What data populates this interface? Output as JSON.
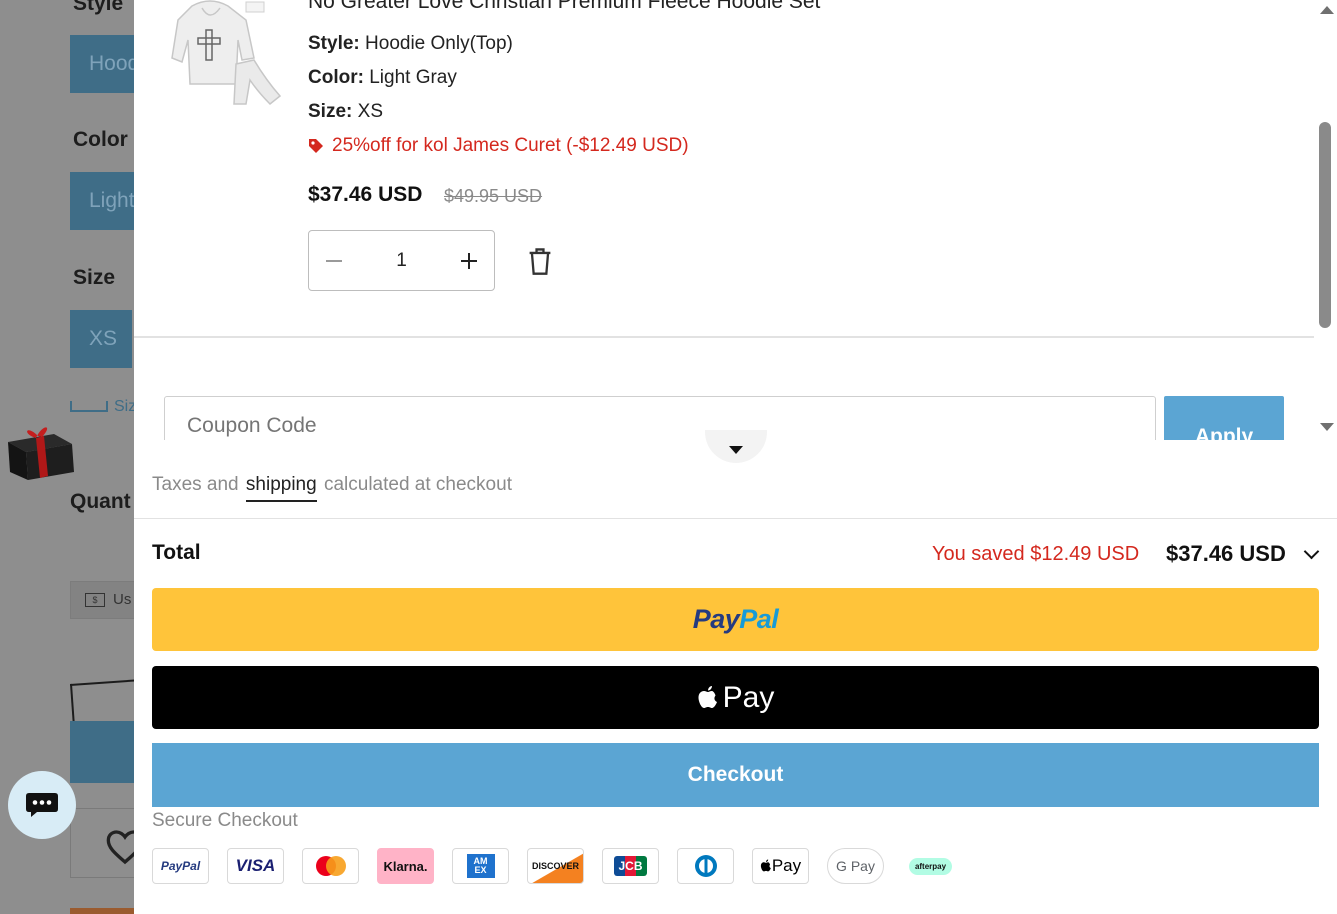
{
  "background_page": {
    "style_label": "Style",
    "style_value": "Hood",
    "color_label": "Color",
    "color_value": "Light",
    "size_label": "Size",
    "size_value": "XS",
    "size_guide": "Siz",
    "quantity_label": "Quant",
    "currency_label": "Us"
  },
  "cart": {
    "item": {
      "title": "No Greater Love Christian Premium Fleece Hoodie Set",
      "style_label": "Style:",
      "style_value": "Hoodie Only(Top)",
      "color_label": "Color:",
      "color_value": "Light Gray",
      "size_label": "Size:",
      "size_value": "XS",
      "discount": "25%off for kol James Curet (-$12.49 USD)",
      "price": "$37.46 USD",
      "compare_price": "$49.95 USD",
      "quantity": "1"
    },
    "coupon": {
      "placeholder": "Coupon Code",
      "apply_label": "Apply"
    },
    "tax_note": {
      "before": "Taxes and",
      "link": "shipping",
      "after": "calculated at checkout"
    },
    "total": {
      "label": "Total",
      "saved": "You saved $12.49 USD",
      "amount": "$37.46 USD"
    },
    "buttons": {
      "paypal_part1": "Pay",
      "paypal_part2": "Pal",
      "applepay": "Pay",
      "checkout": "Checkout"
    },
    "secure_label": "Secure Checkout",
    "payment_icons": [
      {
        "name": "paypal",
        "label": "PayPal"
      },
      {
        "name": "visa",
        "label": "VISA"
      },
      {
        "name": "mastercard",
        "label": ""
      },
      {
        "name": "klarna",
        "label": "Klarna."
      },
      {
        "name": "amex",
        "label": "AM EX"
      },
      {
        "name": "discover",
        "label": "DISCOVER"
      },
      {
        "name": "jcb",
        "label": "JCB"
      },
      {
        "name": "diners",
        "label": ""
      },
      {
        "name": "apple-pay",
        "label": "Pay"
      },
      {
        "name": "google-pay",
        "label": "G Pay"
      },
      {
        "name": "afterpay",
        "label": "afterpay"
      }
    ]
  },
  "colors": {
    "accent_blue": "#5ba5d3",
    "discount_red": "#d4281e",
    "paypal_yellow": "#ffc43a"
  }
}
